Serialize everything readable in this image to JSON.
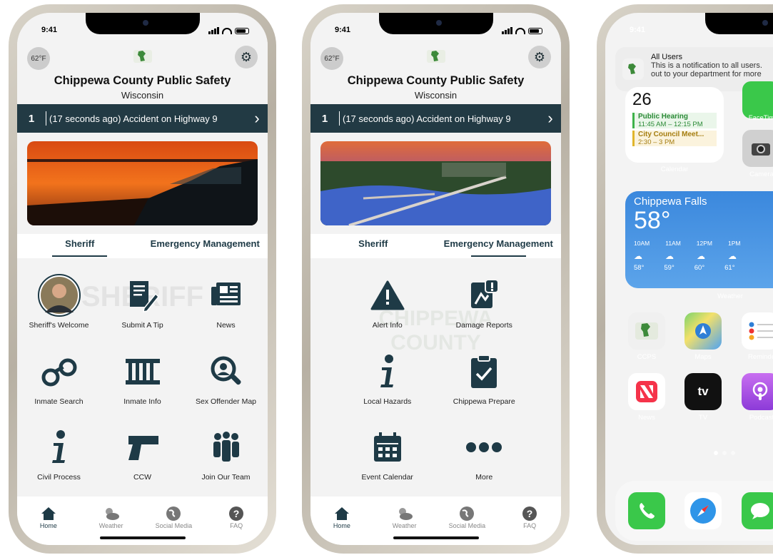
{
  "common": {
    "time": "9:41",
    "temp": "62°F",
    "title": "Chippewa County Public Safety",
    "subtitle": "Wisconsin",
    "ticker_num": "1",
    "ticker_msg": "(17 seconds ago) Accident on Highway 9",
    "nav": [
      "Home",
      "Weather",
      "Social Media",
      "FAQ"
    ]
  },
  "phone1": {
    "tabs": [
      "Sheriff",
      "Emergency Management"
    ],
    "tiles": [
      "Sheriff's Welcome",
      "Submit A Tip",
      "News",
      "Inmate Search",
      "Inmate Info",
      "Sex Offender Map",
      "Civil Process",
      "CCW",
      "Join Our Team"
    ],
    "watermark": "SHERIFF"
  },
  "phone2": {
    "tabs": [
      "Sheriff",
      "Emergency Management"
    ],
    "tiles": [
      "Alert Info",
      "Damage Reports",
      "Local Hazards",
      "Chippewa Prepare",
      "Event Calendar",
      "More"
    ],
    "watermark": "CHIPPEWA COUNTY"
  },
  "phone3": {
    "time": "9:41",
    "notif_title": "All Users",
    "notif_body1": "This is a notification to all users.",
    "notif_body2": "out to your department for more",
    "cal_day": "26",
    "events": [
      {
        "name": "Public Hearing",
        "time": "11:45 AM – 12:15 PM",
        "color": "#3db24a"
      },
      {
        "name": "City Council Meet...",
        "time": "2:30 – 3 PM",
        "color": "#e0b52b"
      }
    ],
    "cal_label": "Calendar",
    "facetime": "FaceTim",
    "camera": "Camera",
    "weather": {
      "city": "Chippewa Falls",
      "temp": "58°",
      "hours": [
        "10AM",
        "11AM",
        "12PM",
        "1PM"
      ],
      "temps": [
        "58°",
        "59°",
        "60°",
        "61°"
      ],
      "label": "Weather"
    },
    "apps_row1": [
      "CCPS",
      "Maps",
      "Reminde"
    ],
    "apps_row2": [
      "News",
      "TV",
      "Podcast"
    ],
    "accent": "#2f7fd6"
  }
}
